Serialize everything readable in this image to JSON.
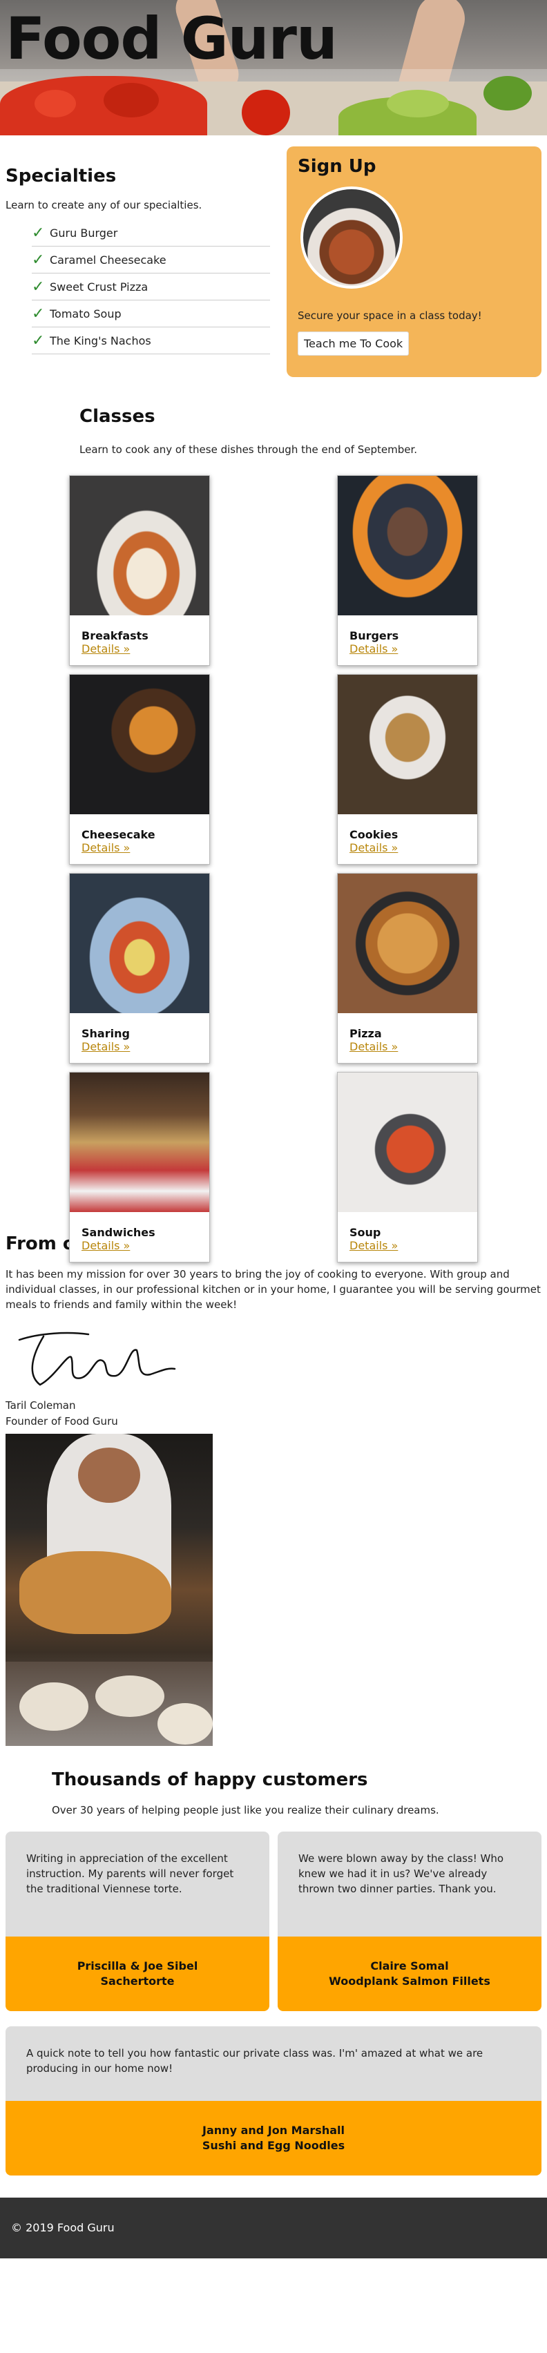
{
  "hero": {
    "title": "Food Guru"
  },
  "specialties": {
    "title": "Specialties",
    "intro": "Learn to create any of our specialties.",
    "items": [
      "Guru Burger",
      "Caramel Cheesecake",
      "Sweet Crust Pizza",
      "Tomato Soup",
      "The King's Nachos"
    ]
  },
  "signup": {
    "title": "Sign Up",
    "text": "Secure your space in a class today!",
    "button": "Teach me To Cook"
  },
  "classes": {
    "title": "Classes",
    "intro": "Learn to cook any of these dishes through the end of September.",
    "link_label": "Details »",
    "items": [
      "Breakfasts",
      "Burgers",
      "Cheesecake",
      "Cookies",
      "Sharing",
      "Pizza",
      "Sandwiches",
      "Soup"
    ]
  },
  "founder": {
    "title": "From our founder",
    "message": "It has been my mission for over 30 years to bring the joy of cooking to everyone. With group and individual classes, in our professional kitchen or in your home, I guarantee you will be serving gourmet meals to friends and family within the week!",
    "name": "Taril Coleman",
    "role": "Founder of Food Guru"
  },
  "testimonials": {
    "title": "Thousands of happy customers",
    "subtitle": "Over 30 years of helping people just like you realize their culinary dreams.",
    "items": [
      {
        "quote": "Writing in appreciation of the excellent instruction. My parents will never forget the traditional Viennese torte.",
        "who": "Priscilla & Joe Sibel",
        "dish": "Sachertorte"
      },
      {
        "quote": "We were blown away by the class! Who knew we had it in us? We've already thrown two dinner parties. Thank you.",
        "who": "Claire Somal",
        "dish": "Woodplank Salmon Fillets"
      },
      {
        "quote": "A quick note to tell you how fantastic our private class was. I'm' amazed at what we are producing in our home now!",
        "who": "Janny and Jon Marshall",
        "dish": "Sushi and Egg Noodles"
      }
    ]
  },
  "footer": {
    "text": "© 2019 Food Guru"
  }
}
